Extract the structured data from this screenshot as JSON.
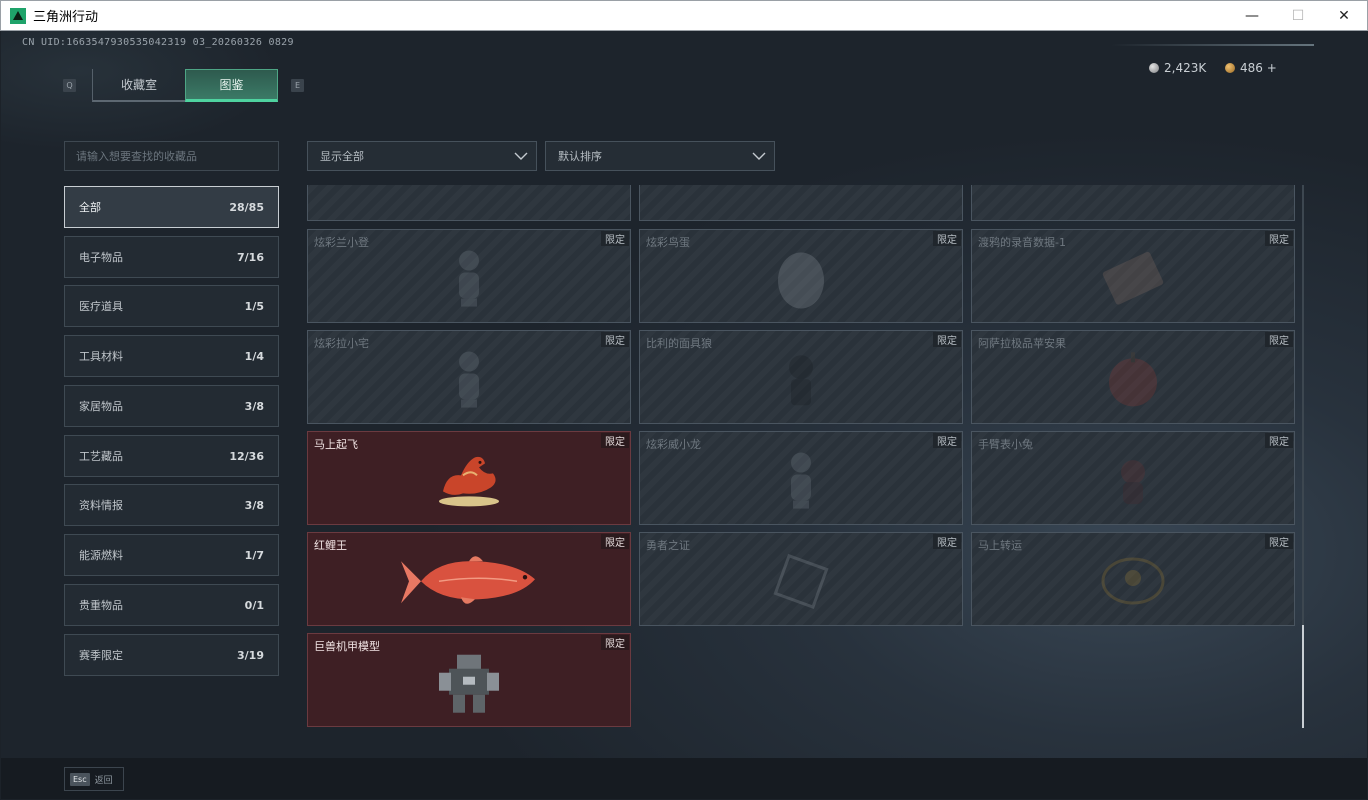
{
  "window": {
    "title": "三角洲行动",
    "controls": {
      "minimize": "—",
      "maximize": "☐",
      "close": "✕"
    }
  },
  "header": {
    "uid": "CN UID:1663547930535042319 03_20260326 0829",
    "tab_prev_key": "Q",
    "tab_next_key": "E",
    "tabs": [
      {
        "label": "收藏室",
        "active": false
      },
      {
        "label": "图鉴",
        "active": true
      }
    ],
    "currency": [
      {
        "icon": "silver-coin-icon",
        "value": "2,423K"
      },
      {
        "icon": "gold-coin-icon",
        "value": "486 +"
      }
    ]
  },
  "search": {
    "placeholder": "请输入想要查找的收藏品",
    "value": ""
  },
  "filters": {
    "display": "显示全部",
    "sort": "默认排序"
  },
  "categories": [
    {
      "label": "全部",
      "count": "28/85",
      "active": true
    },
    {
      "label": "电子物品",
      "count": "7/16"
    },
    {
      "label": "医疗道具",
      "count": "1/5"
    },
    {
      "label": "工具材料",
      "count": "1/4"
    },
    {
      "label": "家居物品",
      "count": "3/8"
    },
    {
      "label": "工艺藏品",
      "count": "12/36"
    },
    {
      "label": "资料情报",
      "count": "3/8"
    },
    {
      "label": "能源燃料",
      "count": "1/7"
    },
    {
      "label": "贵重物品",
      "count": "0/1"
    },
    {
      "label": "赛季限定",
      "count": "3/19"
    }
  ],
  "items": [
    {
      "name": "炫彩兰小登",
      "tag": "限定",
      "unlocked": false,
      "icon": "figurine-icon"
    },
    {
      "name": "炫彩鸟蛋",
      "tag": "限定",
      "unlocked": false,
      "icon": "egg-icon"
    },
    {
      "name": "渡鸦的录音数据-1",
      "tag": "限定",
      "unlocked": false,
      "icon": "tape-icon"
    },
    {
      "name": "炫彩拉小宅",
      "tag": "限定",
      "unlocked": false,
      "icon": "figurine-icon"
    },
    {
      "name": "比利的面具狼",
      "tag": "限定",
      "unlocked": false,
      "icon": "wolf-mask-icon"
    },
    {
      "name": "阿萨拉极品苹安果",
      "tag": "限定",
      "unlocked": false,
      "icon": "apple-icon"
    },
    {
      "name": "马上起飞",
      "tag": "限定",
      "unlocked": true,
      "icon": "horse-statue-icon"
    },
    {
      "name": "炫彩威小龙",
      "tag": "限定",
      "unlocked": false,
      "icon": "figurine-icon"
    },
    {
      "name": "手臂表小兔",
      "tag": "限定",
      "unlocked": false,
      "icon": "rabbit-icon"
    },
    {
      "name": "红鲤王",
      "tag": "限定",
      "unlocked": true,
      "icon": "carp-fish-icon"
    },
    {
      "name": "勇者之证",
      "tag": "限定",
      "unlocked": false,
      "icon": "badge-icon"
    },
    {
      "name": "马上转运",
      "tag": "限定",
      "unlocked": false,
      "icon": "coin-plate-icon"
    },
    {
      "name": "巨兽机甲模型",
      "tag": "限定",
      "unlocked": true,
      "icon": "mech-model-icon"
    }
  ],
  "footer": {
    "esc_key": "Esc",
    "back_label": "返回"
  },
  "colors": {
    "accent": "#4fd3a0",
    "unlocked_card": "#3e1f24",
    "background": "#1c2229"
  }
}
